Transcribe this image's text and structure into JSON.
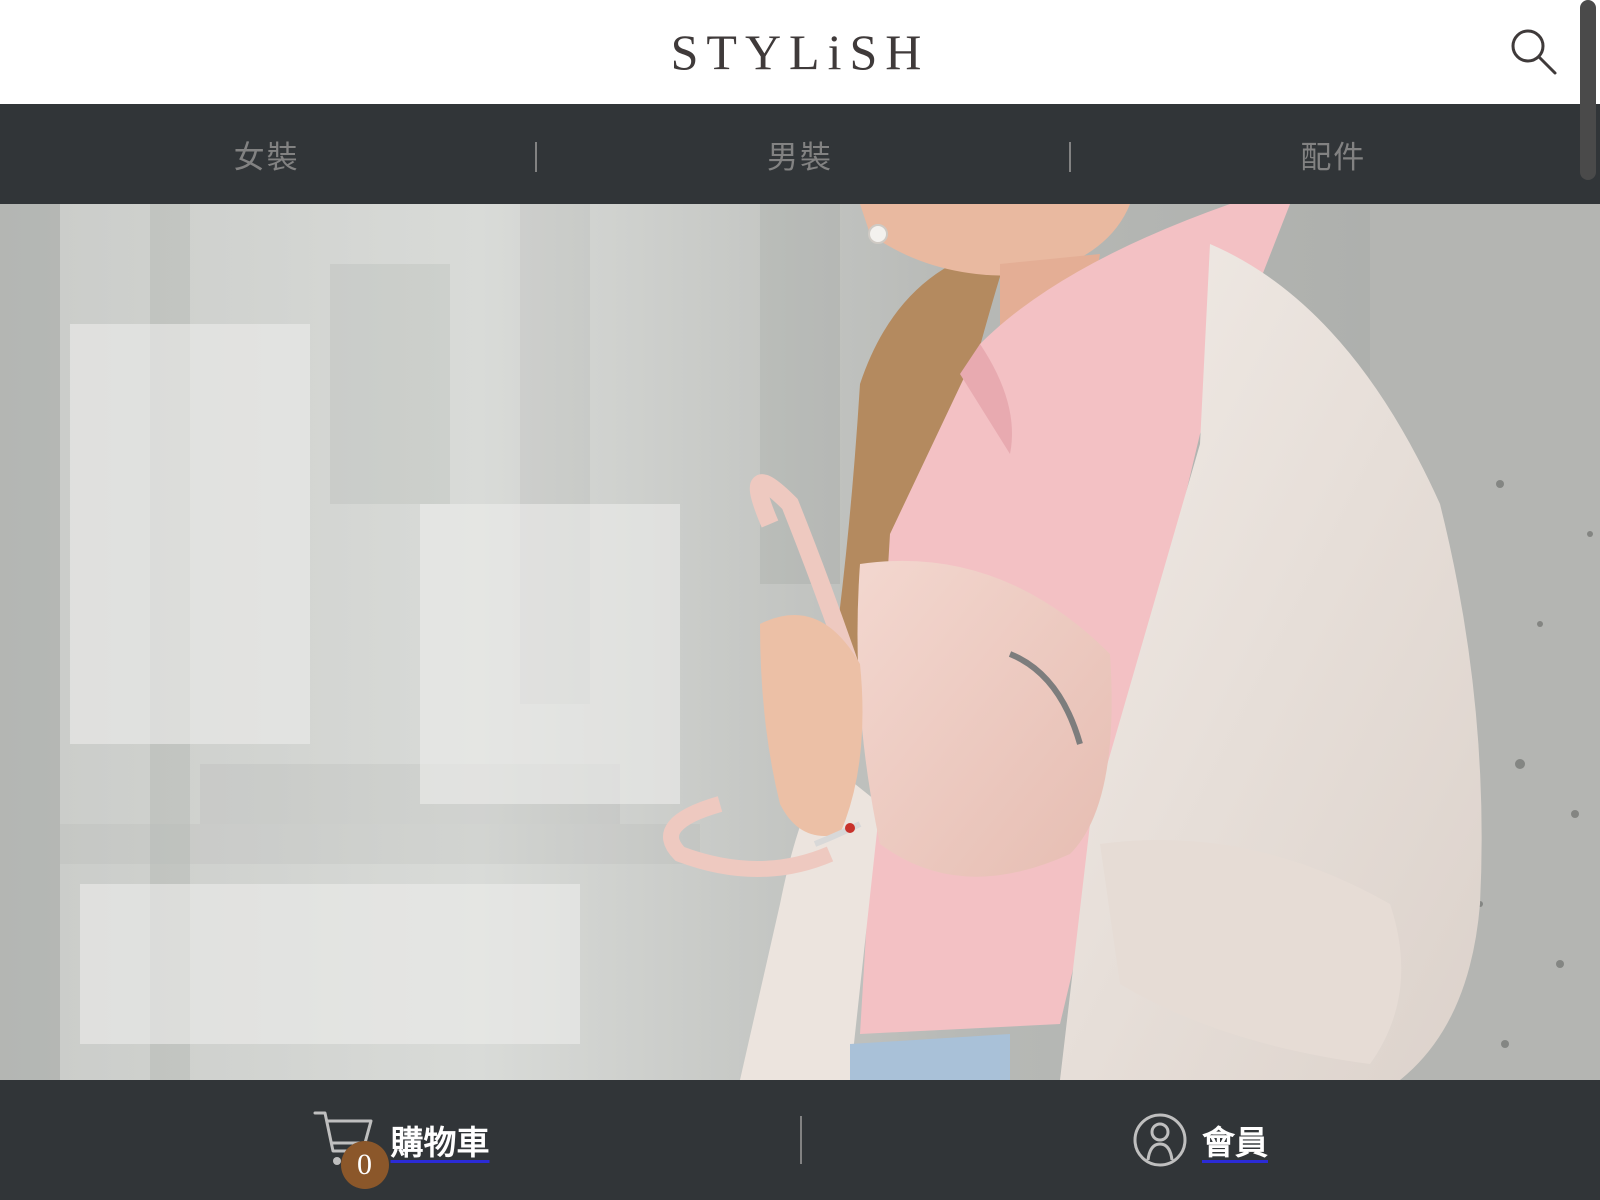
{
  "header": {
    "logo": "STYLiSH",
    "search_icon": "search-icon"
  },
  "nav": {
    "items": [
      {
        "label": "女裝"
      },
      {
        "label": "男裝"
      },
      {
        "label": "配件"
      }
    ]
  },
  "hero": {
    "image": "woman-with-pink-bag-photo"
  },
  "bottom_bar": {
    "cart": {
      "label": "購物車",
      "count": "0",
      "icon": "cart-icon"
    },
    "member": {
      "label": "會員",
      "icon": "member-icon"
    }
  },
  "colors": {
    "header_bg": "#ffffff",
    "nav_bg": "#313538",
    "nav_text": "#828282",
    "logo": "#3f3a3a",
    "badge": "#8b572a"
  }
}
